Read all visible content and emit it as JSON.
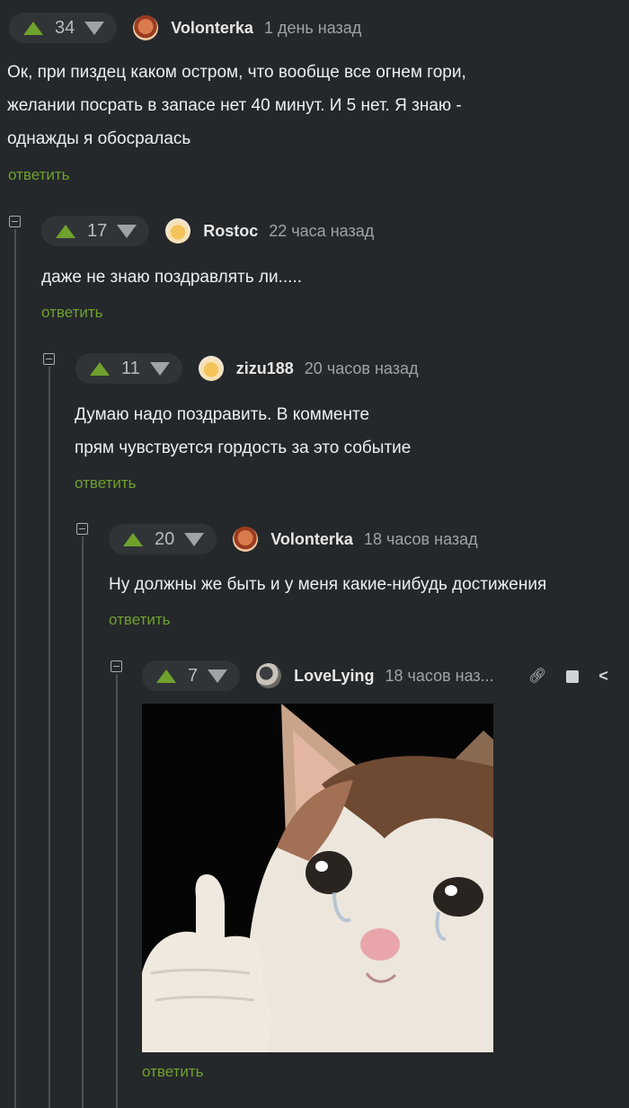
{
  "comments": [
    {
      "score": "34",
      "author": "Volonterka",
      "time": "1 день назад",
      "lines": [
        "Ок, при пиздец каком остром, что вообще все огнем гори,",
        "желании посрать в запасе нет 40 минут. И 5 нет. Я знаю -",
        "однажды я обосралась"
      ]
    },
    {
      "score": "17",
      "author": "Rostoc",
      "time": "22 часа назад",
      "lines": [
        "даже не знаю поздравлять ли....."
      ]
    },
    {
      "score": "11",
      "author": "zizu188",
      "time": "20 часов назад",
      "lines": [
        "Думаю надо поздравить. В комменте",
        "прям чувствуется гордость за это событие"
      ]
    },
    {
      "score": "20",
      "author": "Volonterka",
      "time": "18 часов назад",
      "lines": [
        "Ну должны же быть и у меня какие-нибудь достижения"
      ]
    },
    {
      "score": "7",
      "author": "LoveLying",
      "time": "18 часов наз...",
      "lines": []
    }
  ],
  "reply_label": "ответить",
  "icons": [
    "link-icon",
    "save-icon",
    "share-icon",
    "more-icon"
  ],
  "colors": {
    "background": "#25282b",
    "accent": "#6fa12d",
    "rating_bg": "#303437"
  }
}
